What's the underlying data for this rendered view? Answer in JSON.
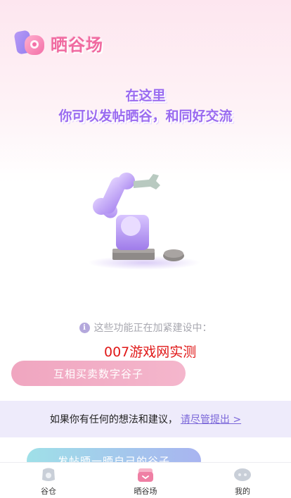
{
  "app": {
    "logo_text": "晒谷场"
  },
  "hero": {
    "line1": "在这里",
    "line2": "你可以发帖晒谷，和同好交流"
  },
  "notice": {
    "icon": "info-icon",
    "icon_glyph": "i",
    "text": "这些功能正在加紧建设中："
  },
  "watermark": "007游戏网实测",
  "features": {
    "trade_label": "互相买卖数字谷子",
    "post_label": "发帖晒一晒自己的谷子"
  },
  "feedback": {
    "text": "如果你有任何的想法和建议，",
    "link": "请尽管提出 >"
  },
  "tabbar": {
    "items": [
      {
        "label": "谷仓",
        "icon": "barn-icon"
      },
      {
        "label": "晒谷场",
        "icon": "threshing-floor-icon"
      },
      {
        "label": "我的",
        "icon": "profile-icon"
      }
    ]
  },
  "colors": {
    "brand_pink": "#f06aa0",
    "brand_purple": "#9a6bf0",
    "watermark_red": "#e01818"
  }
}
